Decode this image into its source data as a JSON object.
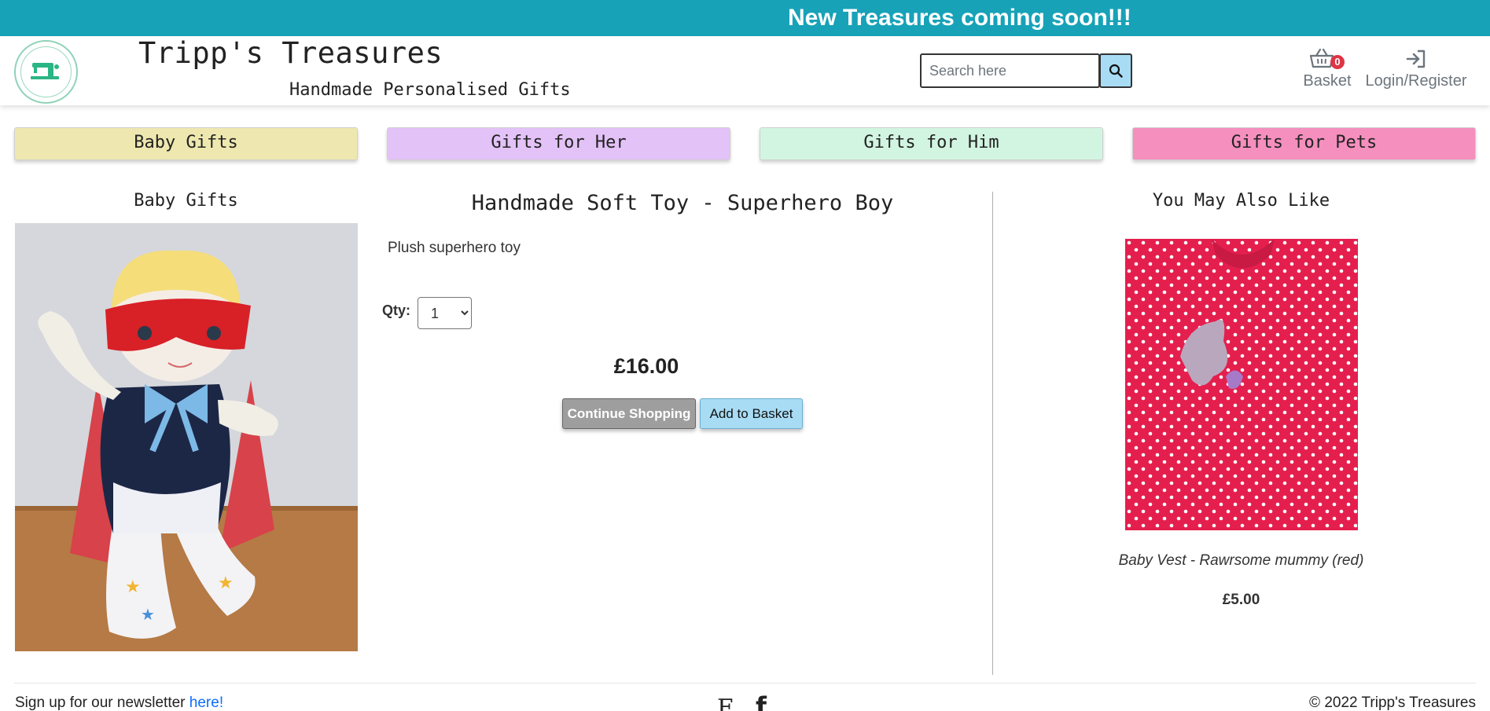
{
  "banner": {
    "text": "New Treasures coming soon!!!"
  },
  "header": {
    "logo_text": "Tripp's Treasures",
    "title": "Tripp's Treasures",
    "tagline": "Handmade Personalised Gifts",
    "search": {
      "placeholder": "Search here",
      "value": ""
    },
    "basket": {
      "label": "Basket",
      "count": "0"
    },
    "login": {
      "label": "Login/Register"
    }
  },
  "nav": {
    "categories": [
      {
        "label": "Baby Gifts",
        "color": "#eee8b0"
      },
      {
        "label": "Gifts for Her",
        "color": "#e3c2f7"
      },
      {
        "label": "Gifts for Him",
        "color": "#d2f5e1"
      },
      {
        "label": "Gifts for Pets",
        "color": "#f58fbe"
      }
    ]
  },
  "product": {
    "category": "Baby Gifts",
    "title": "Handmade Soft Toy - Superhero Boy",
    "description": "Plush superhero toy",
    "qty_label": "Qty:",
    "qty_value": "1",
    "price": "£16.00",
    "continue_label": "Continue Shopping",
    "add_label": "Add to Basket"
  },
  "related": {
    "heading": "You May Also Like",
    "items": [
      {
        "name": "Baby Vest - Rawrsome mummy (red)",
        "price": "£5.00"
      }
    ]
  },
  "footer": {
    "newsletter_text": "Sign up for our newsletter ",
    "newsletter_link": "here!",
    "copyright": "© 2022 Tripp's Treasures"
  },
  "colors": {
    "banner": "#17a2b8",
    "search_button": "#a8dcf5",
    "basket_badge": "#dc3545",
    "continue_button": "#9e9e9e",
    "add_button": "#a8dcf5"
  }
}
